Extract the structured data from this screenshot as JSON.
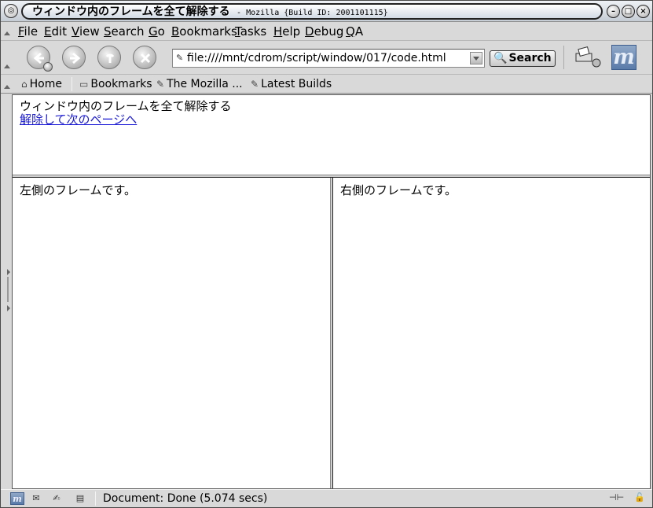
{
  "titlebar": {
    "title": "ウィンドウ内のフレームを全て解除する",
    "subtitle": "- Mozilla {Build ID: 2001101115}"
  },
  "menu": [
    "File",
    "Edit",
    "View",
    "Search",
    "Go",
    "Bookmarks",
    "Tasks",
    "Help",
    "Debug",
    "QA"
  ],
  "navbar": {
    "url": "file:////mnt/cdrom/script/window/017/code.html",
    "search_label": "Search"
  },
  "personal_toolbar": {
    "home": "Home",
    "bookmarks": "Bookmarks",
    "mozilla": "The Mozilla ...",
    "latest": "Latest Builds"
  },
  "page": {
    "top_heading": "ウィンドウ内のフレームを全て解除する",
    "top_link": "解除して次のページへ",
    "left_text": "左側のフレームです。",
    "right_text": "右側のフレームです。"
  },
  "status": {
    "text": "Document: Done (5.074 secs)"
  }
}
